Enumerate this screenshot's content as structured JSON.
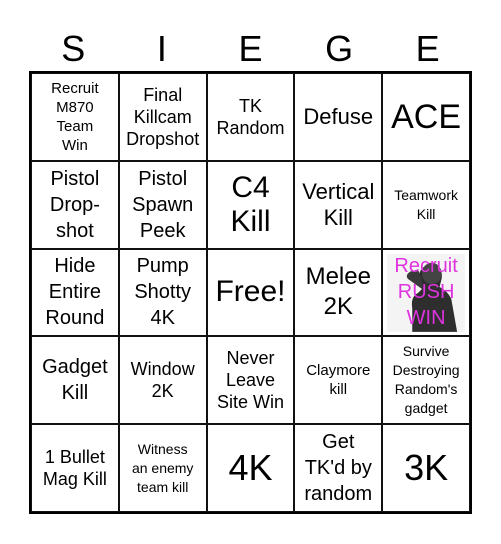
{
  "title_letters": [
    "S",
    "I",
    "E",
    "G",
    "E"
  ],
  "cells": [
    {
      "text": "Recruit\nM870\nTeam\nWin"
    },
    {
      "text": "Final\nKillcam\nDropshot"
    },
    {
      "text": "TK\nRandom"
    },
    {
      "text": "Defuse"
    },
    {
      "text": "ACE"
    },
    {
      "text": "Pistol\nDrop-\nshot"
    },
    {
      "text": "Pistol\nSpawn\nPeek"
    },
    {
      "text": "C4\nKill"
    },
    {
      "text": "Vertical\nKill"
    },
    {
      "text": "Teamwork\nKill"
    },
    {
      "text": "Hide\nEntire\nRound"
    },
    {
      "text": "Pump\nShotty\n4K"
    },
    {
      "text": "Free!"
    },
    {
      "text": "Melee\n2K"
    },
    {
      "text": "Recruit\nRUSH\nWIN",
      "color": "#e033e0",
      "image": "saluting-soldier"
    },
    {
      "text": "Gadget\nKill"
    },
    {
      "text": "Window\n2K"
    },
    {
      "text": "Never\nLeave\nSite Win"
    },
    {
      "text": "Claymore\nkill"
    },
    {
      "text": "Survive\nDestroying\nRandom's\ngadget"
    },
    {
      "text": "1 Bullet\nMag Kill"
    },
    {
      "text": "Witness\nan enemy\nteam kill"
    },
    {
      "text": "4K"
    },
    {
      "text": "Get\nTK'd by\nrandom"
    },
    {
      "text": "3K"
    }
  ]
}
